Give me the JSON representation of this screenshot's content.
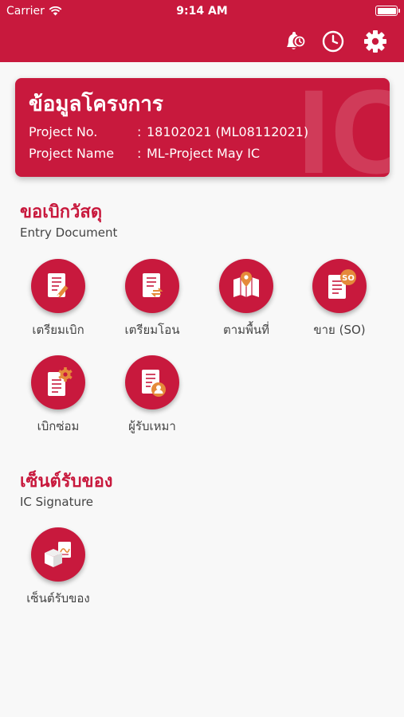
{
  "status_bar": {
    "carrier": "Carrier",
    "time": "9:14 AM"
  },
  "header": {
    "icons": [
      "reminder-icon",
      "clock-icon",
      "gear-icon"
    ]
  },
  "project_card": {
    "title": "ข้อมูลโครงการ",
    "watermark": "IC",
    "project_no_label": "Project No.",
    "project_no_value": "18102021 (ML08112021)",
    "project_name_label": "Project Name",
    "project_name_value": "ML-Project May IC",
    "colon": ":"
  },
  "entry_section": {
    "title": "ขอเบิกวัสดุ",
    "subtitle": "Entry Document",
    "items": [
      {
        "label": "เตรียมเบิก",
        "icon": "document-edit-icon"
      },
      {
        "label": "เตรียมโอน",
        "icon": "document-transfer-icon"
      },
      {
        "label": "ตามพื้นที่",
        "icon": "map-pin-icon"
      },
      {
        "label": "ขาย (SO)",
        "icon": "document-so-icon",
        "badge": "SO"
      },
      {
        "label": "เบิกซ่อม",
        "icon": "document-repair-icon"
      },
      {
        "label": "ผู้รับเหมา",
        "icon": "document-contractor-icon"
      }
    ]
  },
  "signature_section": {
    "title": "เซ็นต์รับของ",
    "subtitle": "IC Signature",
    "items": [
      {
        "label": "เซ็นต์รับของ",
        "icon": "box-signature-icon"
      }
    ]
  },
  "colors": {
    "primary": "#c8193d",
    "background": "#f8f8f8",
    "text": "#444444"
  }
}
